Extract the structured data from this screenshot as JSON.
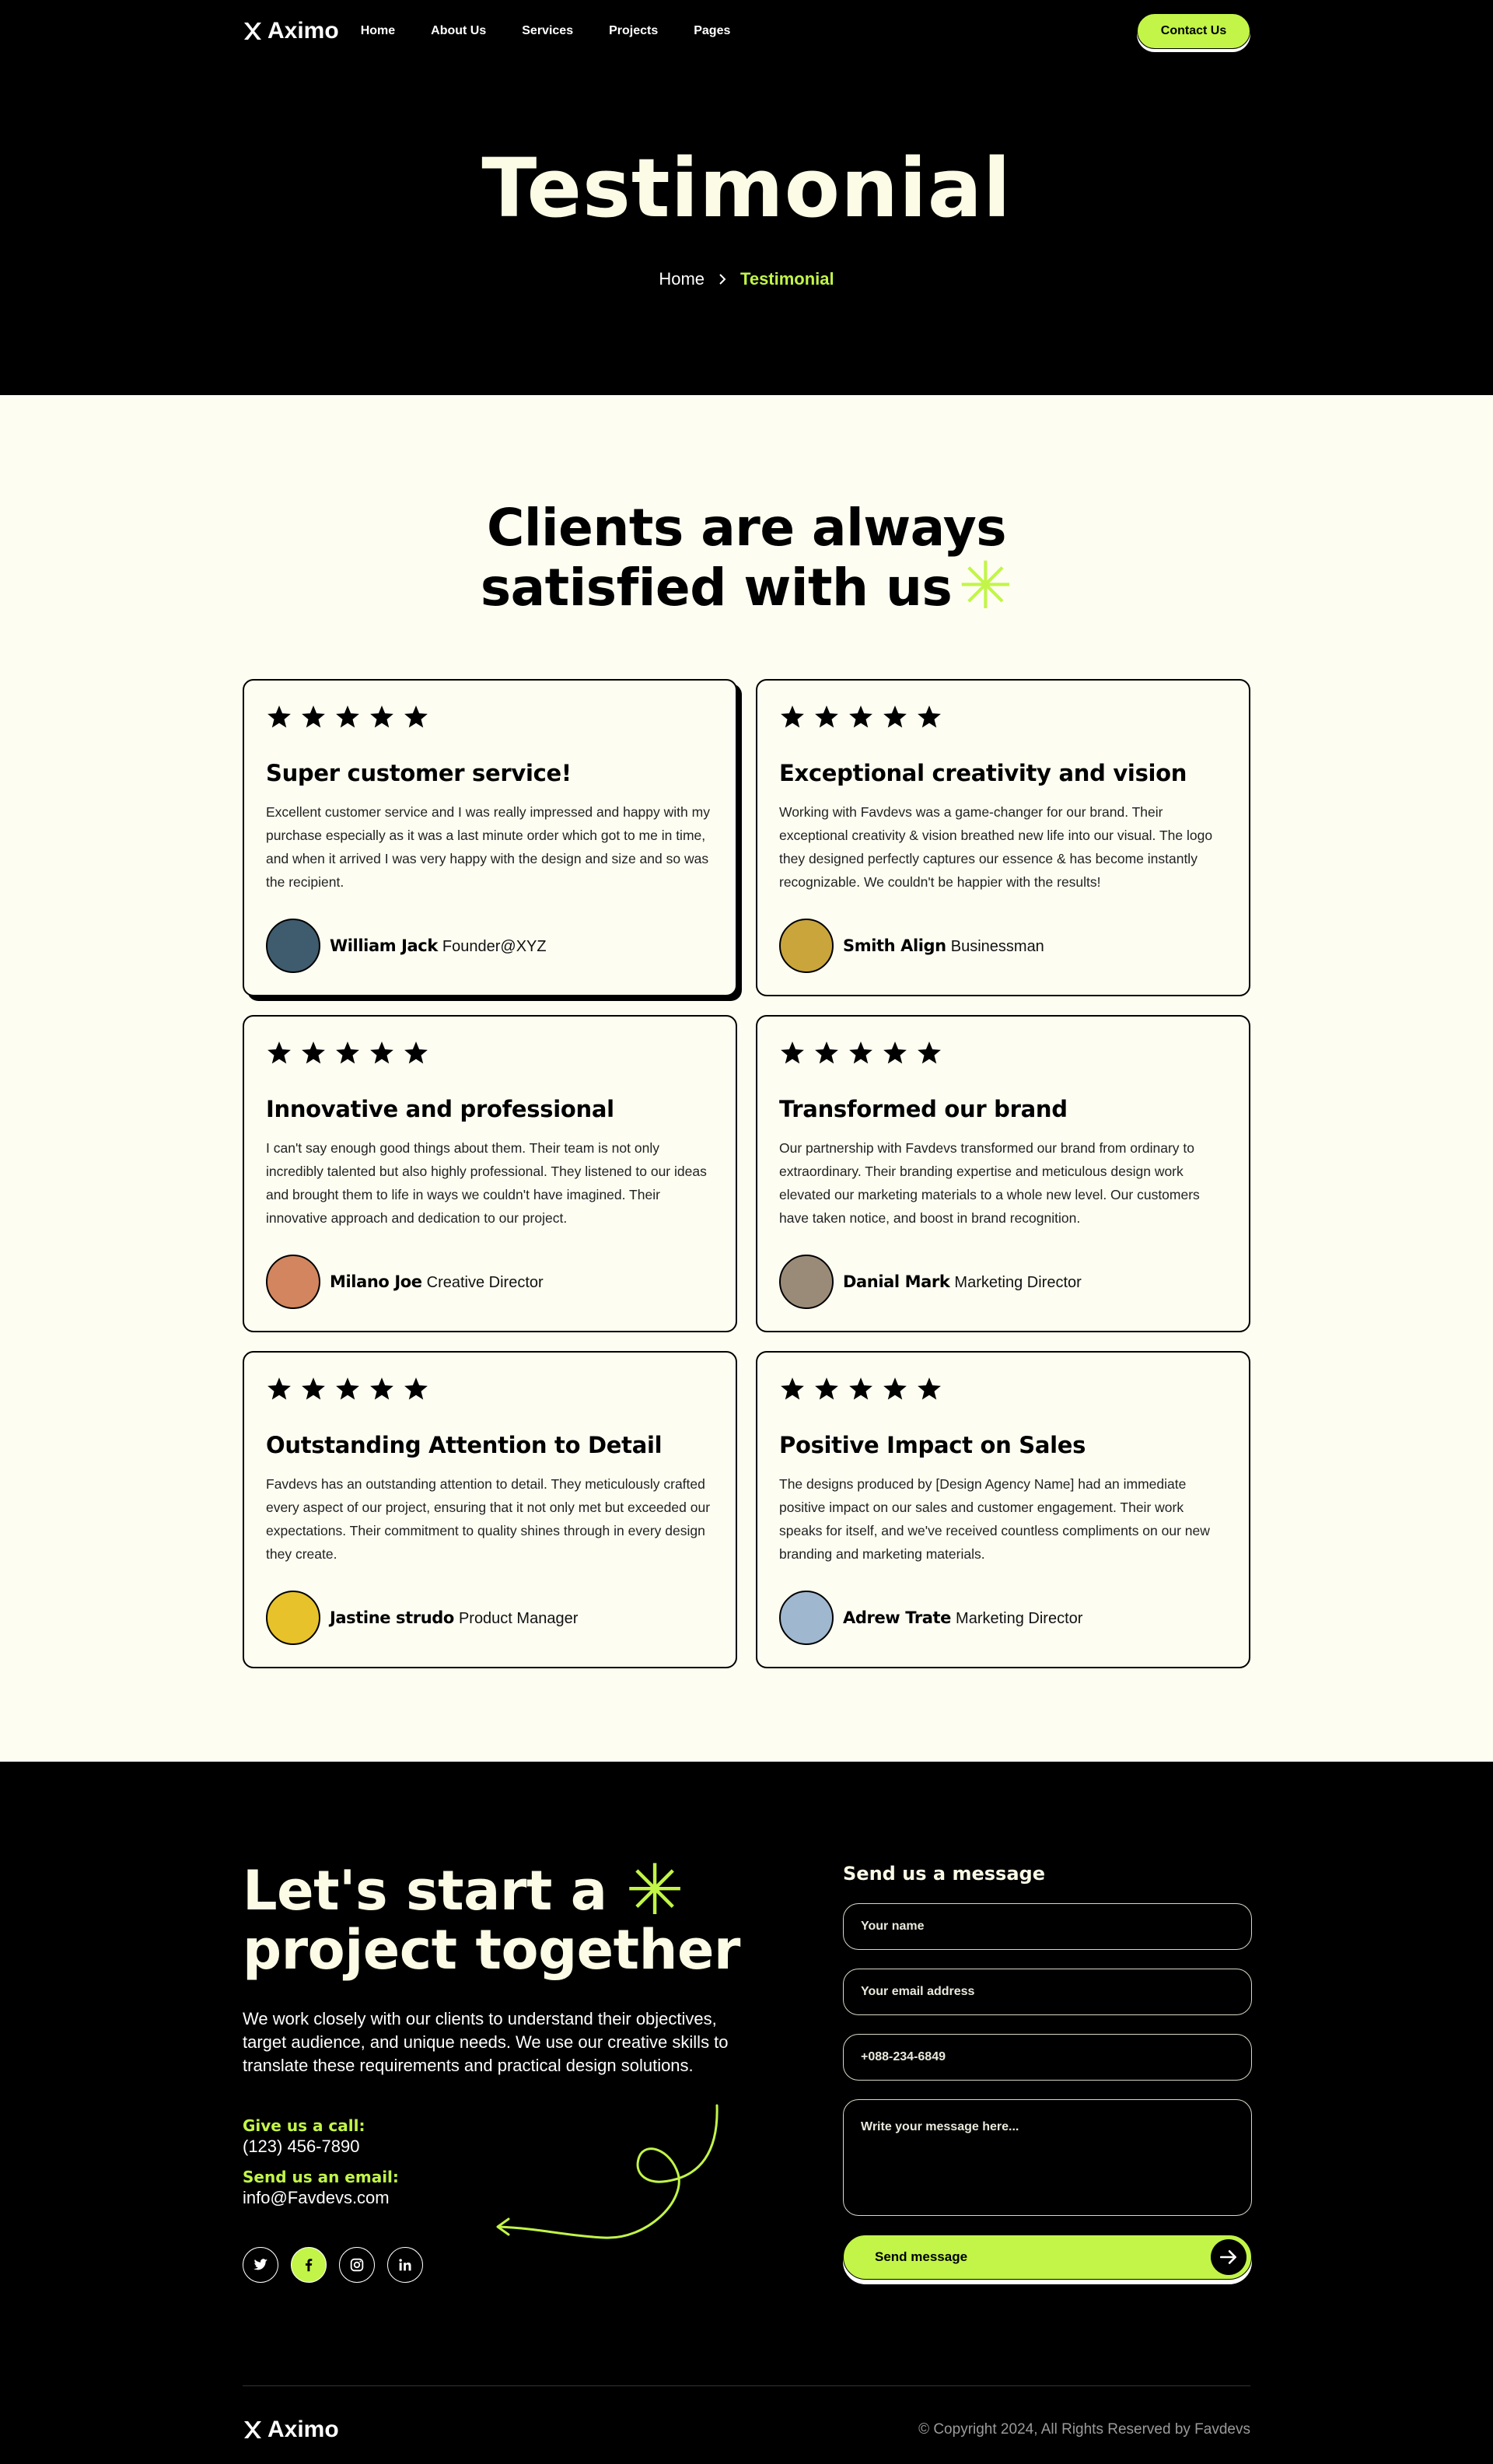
{
  "nav": {
    "brand": "Aximo",
    "items": [
      "Home",
      "About Us",
      "Services",
      "Projects",
      "Pages"
    ],
    "cta": "Contact Us"
  },
  "hero": {
    "title": "Testimonial",
    "breadcrumb_home": "Home",
    "breadcrumb_current": "Testimonial"
  },
  "testimonials": {
    "title_line1": "Clients are always",
    "title_line2": "satisfied with us",
    "cards": [
      {
        "title": "Super customer service!",
        "text": "Excellent customer service and I was really impressed and happy with my purchase especially as it was a last minute order which got to me in time, and when it arrived I was very happy with the design and size and so was the recipient.",
        "name": "William Jack",
        "role": "Founder@XYZ"
      },
      {
        "title": "Exceptional creativity and vision",
        "text": "Working with Favdevs was a game-changer for our brand. Their exceptional creativity & vision breathed new life into our visual. The logo they designed perfectly captures our essence & has become instantly recognizable. We couldn't be happier with the results!",
        "name": "Smith Align",
        "role": "Businessman"
      },
      {
        "title": "Innovative and professional",
        "text": "I can't say enough good things about them. Their team is not only incredibly talented but also highly professional. They listened to our ideas and brought them to life in ways we couldn't have imagined. Their innovative approach and dedication to our project.",
        "name": "Milano Joe",
        "role": "Creative Director"
      },
      {
        "title": "Transformed our brand",
        "text": "Our partnership with Favdevs transformed our brand from ordinary to extraordinary. Their branding expertise and meticulous design work elevated our marketing materials to a whole new level. Our customers have taken notice, and boost in brand recognition.",
        "name": "Danial Mark",
        "role": "Marketing Director"
      },
      {
        "title": "Outstanding Attention to Detail",
        "text": "Favdevs has an outstanding attention to detail. They meticulously crafted every aspect of our project, ensuring that it not only met but exceeded our expectations. Their commitment to quality shines through in every design they create.",
        "name": "Jastine strudo",
        "role": "Product Manager"
      },
      {
        "title": "Positive Impact on Sales",
        "text": "The designs produced by [Design Agency Name] had an immediate positive impact on our sales and customer engagement. Their work speaks for itself, and we've received countless compliments on our new branding and marketing materials.",
        "name": "Adrew Trate",
        "role": "Marketing Director"
      }
    ]
  },
  "contact": {
    "title_line1": "Let's start a",
    "title_line2": "project together",
    "description": "We work closely with our clients to understand their objectives, target audience, and unique needs. We use our creative skills to translate these requirements and practical design solutions.",
    "call_label": "Give us a call:",
    "phone": "(123) 456-7890",
    "email_label": "Send us an email:",
    "email": "info@Favdevs.com",
    "form": {
      "title": "Send us a message",
      "name_placeholder": "Your name",
      "email_placeholder": "Your email address",
      "phone_value": "+088-234-6849",
      "message_placeholder": "Write your message here...",
      "submit": "Send message"
    }
  },
  "footer": {
    "brand": "Aximo",
    "copyright": "© Copyright 2024, All Rights Reserved by Favdevs"
  },
  "colors": {
    "accent": "#c2f548",
    "dark": "#000000",
    "cream": "#fdfdf2"
  }
}
